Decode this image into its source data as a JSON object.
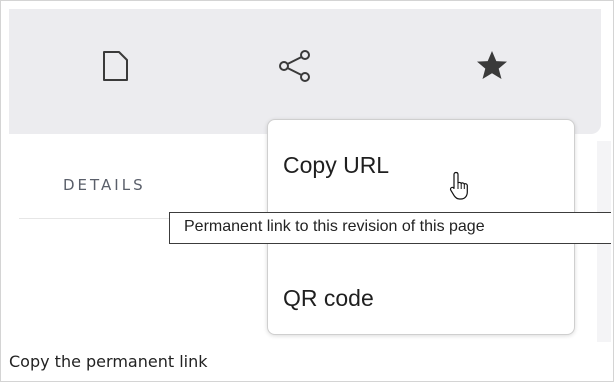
{
  "toolbar": {
    "icons": [
      "file-icon",
      "share-icon",
      "star-icon"
    ],
    "background": "#ececef"
  },
  "panel": {
    "section_label": "DETAILS"
  },
  "share_menu": {
    "items": [
      {
        "label": "Copy URL"
      },
      {
        "label": "QR code"
      }
    ]
  },
  "tooltip": {
    "text": "Permanent link to this revision of this page"
  },
  "caption": {
    "text": "Copy the permanent link"
  }
}
